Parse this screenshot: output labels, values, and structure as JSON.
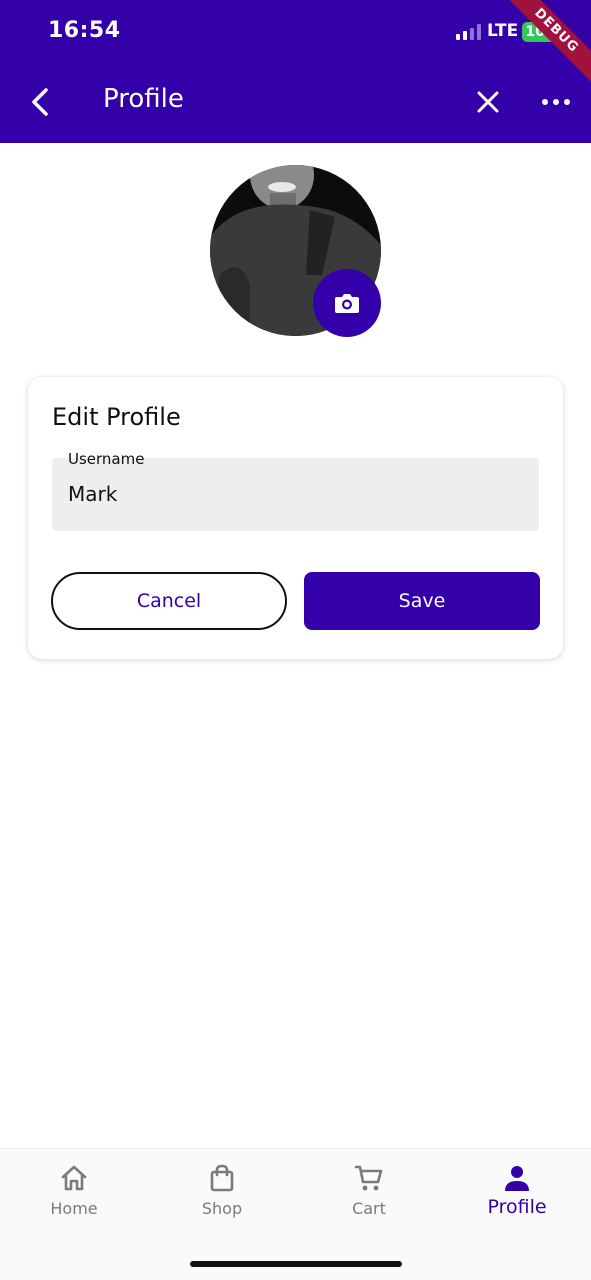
{
  "status_bar": {
    "time": "16:54",
    "network": "LTE",
    "battery": "100",
    "debug_banner": "DEBUG"
  },
  "app_bar": {
    "title": "Profile",
    "back_icon": "chevron-left-icon",
    "close_icon": "close-icon",
    "more_icon": "more-horizontal-icon"
  },
  "avatar": {
    "camera_icon": "camera-icon"
  },
  "edit_card": {
    "title": "Edit Profile",
    "username_label": "Username",
    "username_value": "Mark",
    "cancel_label": "Cancel",
    "save_label": "Save"
  },
  "bottom_nav": {
    "items": [
      {
        "label": "Home",
        "icon": "home-icon",
        "active": false
      },
      {
        "label": "Shop",
        "icon": "shopping-bag-icon",
        "active": false
      },
      {
        "label": "Cart",
        "icon": "cart-icon",
        "active": false
      },
      {
        "label": "Profile",
        "icon": "person-icon",
        "active": true
      }
    ]
  },
  "colors": {
    "primary": "#3300AA",
    "battery": "#34C759",
    "debug": "#A0113E",
    "inactive": "#7A7A7A"
  }
}
